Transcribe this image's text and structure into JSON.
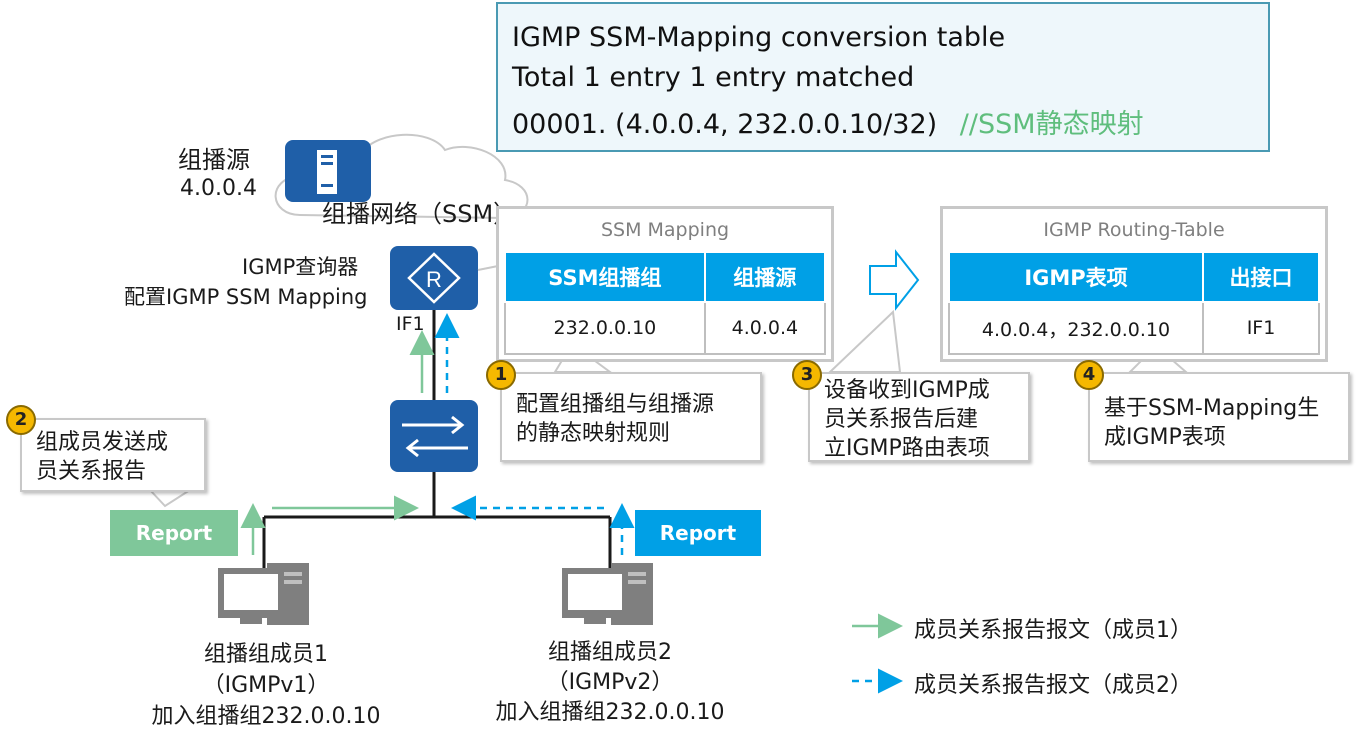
{
  "console": {
    "title": "IGMP SSM-Mapping conversion table",
    "line2": " Total 1 entry    1 entry matched",
    "line3_entry": " 00001. (4.0.0.4, 232.0.0.10/32)",
    "line3_comment": "//SSM静态映射"
  },
  "source": {
    "label": "组播源",
    "ip": "4.0.0.4"
  },
  "cloud_label": "组播网络（SSM）",
  "querier": {
    "line1": "IGMP查询器",
    "line2": "配置IGMP SSM Mapping",
    "interface": "IF1"
  },
  "ssm_mapping": {
    "title": "SSM Mapping",
    "headers": [
      "SSM组播组",
      "组播源"
    ],
    "row": [
      "232.0.0.10",
      "4.0.0.4"
    ]
  },
  "routing_table": {
    "title": "IGMP Routing-Table",
    "headers": [
      "IGMP表项",
      "出接口"
    ],
    "row": [
      "4.0.0.4，232.0.0.10",
      "IF1"
    ]
  },
  "callouts": [
    {
      "num": "1",
      "lines": [
        "配置组播组与组播源",
        "的静态映射规则"
      ]
    },
    {
      "num": "2",
      "lines": [
        "组成员发送成",
        "员关系报告"
      ]
    },
    {
      "num": "3",
      "lines": [
        "设备收到IGMP成",
        "员关系报告后建",
        "立IGMP路由表项"
      ]
    },
    {
      "num": "4",
      "lines": [
        "基于SSM-Mapping生",
        "成IGMP表项"
      ]
    }
  ],
  "report_label": "Report",
  "members": [
    {
      "name": "组播组成员1",
      "version": "（IGMPv1）",
      "join": "加入组播组232.0.0.10"
    },
    {
      "name": "组播组成员2",
      "version": "（IGMPv2）",
      "join": "加入组播组232.0.0.10"
    }
  ],
  "legend": {
    "solid": "成员关系报告报文（成员1）",
    "dashed": "成员关系报告报文（成员2）"
  },
  "colors": {
    "green": "#7fc79a",
    "blue": "#00a0e6",
    "device": "#1f5fa8",
    "badge": "#f5b800"
  }
}
